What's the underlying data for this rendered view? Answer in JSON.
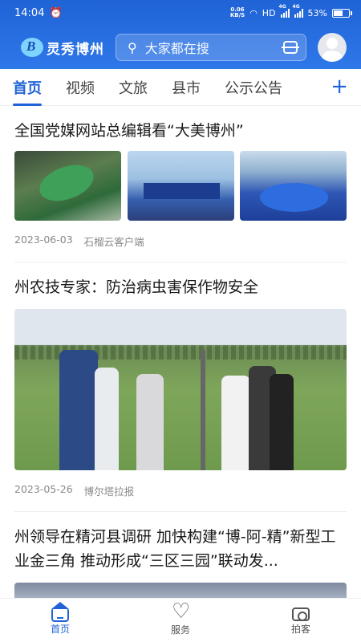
{
  "status_bar": {
    "time": "14:04",
    "speed_value": "0.06",
    "speed_unit": "KB/S",
    "network_hd": "HD",
    "sim1": "4G",
    "sim2": "4G",
    "battery": "53%"
  },
  "app": {
    "logo_text": "灵秀博州",
    "search_placeholder": "大家都在搜"
  },
  "tabs": [
    {
      "label": "首页",
      "active": true
    },
    {
      "label": "视频"
    },
    {
      "label": "文旅"
    },
    {
      "label": "县市"
    },
    {
      "label": "公示公告"
    }
  ],
  "tab_add": "+",
  "articles": [
    {
      "title": "全国党媒网站总编辑看“大美博州”",
      "date": "2023-06-03",
      "source": "石榴云客户端"
    },
    {
      "title": "州农技专家：防治病虫害保作物安全",
      "date": "2023-05-26",
      "source": "博尔塔拉报"
    },
    {
      "title": "州领导在精河县调研 加快构建“博-阿-精”新型工业金三角 推动形成“三区三园”联动发..."
    }
  ],
  "bottom_nav": [
    {
      "label": "首页",
      "icon": "home-icon",
      "active": true
    },
    {
      "label": "服务",
      "icon": "heart-icon"
    },
    {
      "label": "拍客",
      "icon": "camera-icon"
    }
  ],
  "colors": {
    "accent": "#1f63d6",
    "header": "#2f78ea"
  }
}
